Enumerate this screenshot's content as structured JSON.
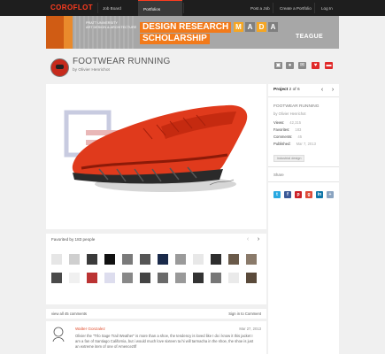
{
  "topbar": {
    "logo": "COROFLOT",
    "nav": [
      "Job Board",
      "Portfolios"
    ],
    "right": [
      "Post a Job",
      "Create a Portfolio",
      "Log In"
    ]
  },
  "banner": {
    "school_line1": "PRATT UNIVERSITY",
    "school_line2": "ART DESIGN & ARCHITECTURE",
    "title_line1": "DESIGN RESEARCH",
    "title_line2": "SCHOLARSHIP",
    "mada": [
      "M",
      "A",
      "D",
      "A"
    ],
    "sponsor": "TEAGUE"
  },
  "project": {
    "title": "FOOTWEAR RUNNING",
    "by": "by Olivier Henrichot"
  },
  "favorites": {
    "label": "Favorited by 183 people"
  },
  "comments": {
    "view_all": "view all 45 comments",
    "sign_in": "Sign in to Comment",
    "first": {
      "name": "Walter Gonzalez",
      "date": "Mar 27, 2013",
      "text": "Olivier the \"Trlo Sage Trail Weather\" is more than a shoe, the tendency is loved like I do i know it this jacket I am a fan of Santiago California, but i would much love sixteen ta hi will tarmacha in the shoe, the shoe is just an extreme item of one of Amenceztlf"
    }
  },
  "sidebar": {
    "project_label": "Project",
    "project_pos": "2 of 6",
    "title": "FOOTWEAR RUNNING",
    "by": "by Olivier Henrichot",
    "stats": [
      {
        "k": "Views:",
        "v": "42,315"
      },
      {
        "k": "Favorites:",
        "v": "183"
      },
      {
        "k": "Comments:",
        "v": "45"
      },
      {
        "k": "Published:",
        "v": "Mar 7, 2013"
      }
    ],
    "tag": "industrial design",
    "share": "Share",
    "social_colors": [
      "#29a9e1",
      "#3b5998",
      "#cb2027",
      "#dd4b39",
      "#0e76a8",
      "#8aa4c1"
    ]
  },
  "colors": {
    "accent": "#ff3c1f",
    "topbar": "#1e1e1e",
    "shoe": "#e03a1c"
  }
}
